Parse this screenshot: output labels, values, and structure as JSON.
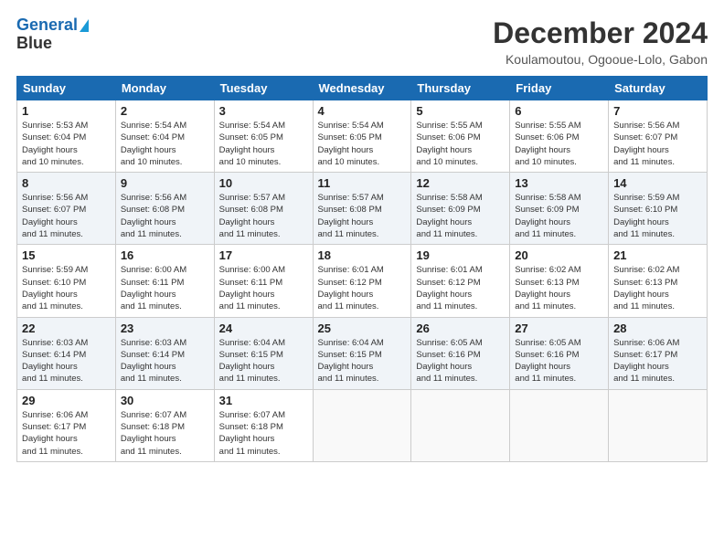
{
  "header": {
    "logo_line1": "General",
    "logo_line2": "Blue",
    "title": "December 2024",
    "subtitle": "Koulamoutou, Ogooue-Lolo, Gabon"
  },
  "days_of_week": [
    "Sunday",
    "Monday",
    "Tuesday",
    "Wednesday",
    "Thursday",
    "Friday",
    "Saturday"
  ],
  "weeks": [
    [
      {
        "day": "1",
        "sunrise": "5:53 AM",
        "sunset": "6:04 PM",
        "daylight": "12 hours and 10 minutes."
      },
      {
        "day": "2",
        "sunrise": "5:54 AM",
        "sunset": "6:04 PM",
        "daylight": "12 hours and 10 minutes."
      },
      {
        "day": "3",
        "sunrise": "5:54 AM",
        "sunset": "6:05 PM",
        "daylight": "12 hours and 10 minutes."
      },
      {
        "day": "4",
        "sunrise": "5:54 AM",
        "sunset": "6:05 PM",
        "daylight": "12 hours and 10 minutes."
      },
      {
        "day": "5",
        "sunrise": "5:55 AM",
        "sunset": "6:06 PM",
        "daylight": "12 hours and 10 minutes."
      },
      {
        "day": "6",
        "sunrise": "5:55 AM",
        "sunset": "6:06 PM",
        "daylight": "12 hours and 10 minutes."
      },
      {
        "day": "7",
        "sunrise": "5:56 AM",
        "sunset": "6:07 PM",
        "daylight": "12 hours and 11 minutes."
      }
    ],
    [
      {
        "day": "8",
        "sunrise": "5:56 AM",
        "sunset": "6:07 PM",
        "daylight": "12 hours and 11 minutes."
      },
      {
        "day": "9",
        "sunrise": "5:56 AM",
        "sunset": "6:08 PM",
        "daylight": "12 hours and 11 minutes."
      },
      {
        "day": "10",
        "sunrise": "5:57 AM",
        "sunset": "6:08 PM",
        "daylight": "12 hours and 11 minutes."
      },
      {
        "day": "11",
        "sunrise": "5:57 AM",
        "sunset": "6:08 PM",
        "daylight": "12 hours and 11 minutes."
      },
      {
        "day": "12",
        "sunrise": "5:58 AM",
        "sunset": "6:09 PM",
        "daylight": "12 hours and 11 minutes."
      },
      {
        "day": "13",
        "sunrise": "5:58 AM",
        "sunset": "6:09 PM",
        "daylight": "12 hours and 11 minutes."
      },
      {
        "day": "14",
        "sunrise": "5:59 AM",
        "sunset": "6:10 PM",
        "daylight": "12 hours and 11 minutes."
      }
    ],
    [
      {
        "day": "15",
        "sunrise": "5:59 AM",
        "sunset": "6:10 PM",
        "daylight": "12 hours and 11 minutes."
      },
      {
        "day": "16",
        "sunrise": "6:00 AM",
        "sunset": "6:11 PM",
        "daylight": "12 hours and 11 minutes."
      },
      {
        "day": "17",
        "sunrise": "6:00 AM",
        "sunset": "6:11 PM",
        "daylight": "12 hours and 11 minutes."
      },
      {
        "day": "18",
        "sunrise": "6:01 AM",
        "sunset": "6:12 PM",
        "daylight": "12 hours and 11 minutes."
      },
      {
        "day": "19",
        "sunrise": "6:01 AM",
        "sunset": "6:12 PM",
        "daylight": "12 hours and 11 minutes."
      },
      {
        "day": "20",
        "sunrise": "6:02 AM",
        "sunset": "6:13 PM",
        "daylight": "12 hours and 11 minutes."
      },
      {
        "day": "21",
        "sunrise": "6:02 AM",
        "sunset": "6:13 PM",
        "daylight": "12 hours and 11 minutes."
      }
    ],
    [
      {
        "day": "22",
        "sunrise": "6:03 AM",
        "sunset": "6:14 PM",
        "daylight": "12 hours and 11 minutes."
      },
      {
        "day": "23",
        "sunrise": "6:03 AM",
        "sunset": "6:14 PM",
        "daylight": "12 hours and 11 minutes."
      },
      {
        "day": "24",
        "sunrise": "6:04 AM",
        "sunset": "6:15 PM",
        "daylight": "12 hours and 11 minutes."
      },
      {
        "day": "25",
        "sunrise": "6:04 AM",
        "sunset": "6:15 PM",
        "daylight": "12 hours and 11 minutes."
      },
      {
        "day": "26",
        "sunrise": "6:05 AM",
        "sunset": "6:16 PM",
        "daylight": "12 hours and 11 minutes."
      },
      {
        "day": "27",
        "sunrise": "6:05 AM",
        "sunset": "6:16 PM",
        "daylight": "12 hours and 11 minutes."
      },
      {
        "day": "28",
        "sunrise": "6:06 AM",
        "sunset": "6:17 PM",
        "daylight": "12 hours and 11 minutes."
      }
    ],
    [
      {
        "day": "29",
        "sunrise": "6:06 AM",
        "sunset": "6:17 PM",
        "daylight": "12 hours and 11 minutes."
      },
      {
        "day": "30",
        "sunrise": "6:07 AM",
        "sunset": "6:18 PM",
        "daylight": "12 hours and 11 minutes."
      },
      {
        "day": "31",
        "sunrise": "6:07 AM",
        "sunset": "6:18 PM",
        "daylight": "12 hours and 11 minutes."
      },
      null,
      null,
      null,
      null
    ]
  ]
}
